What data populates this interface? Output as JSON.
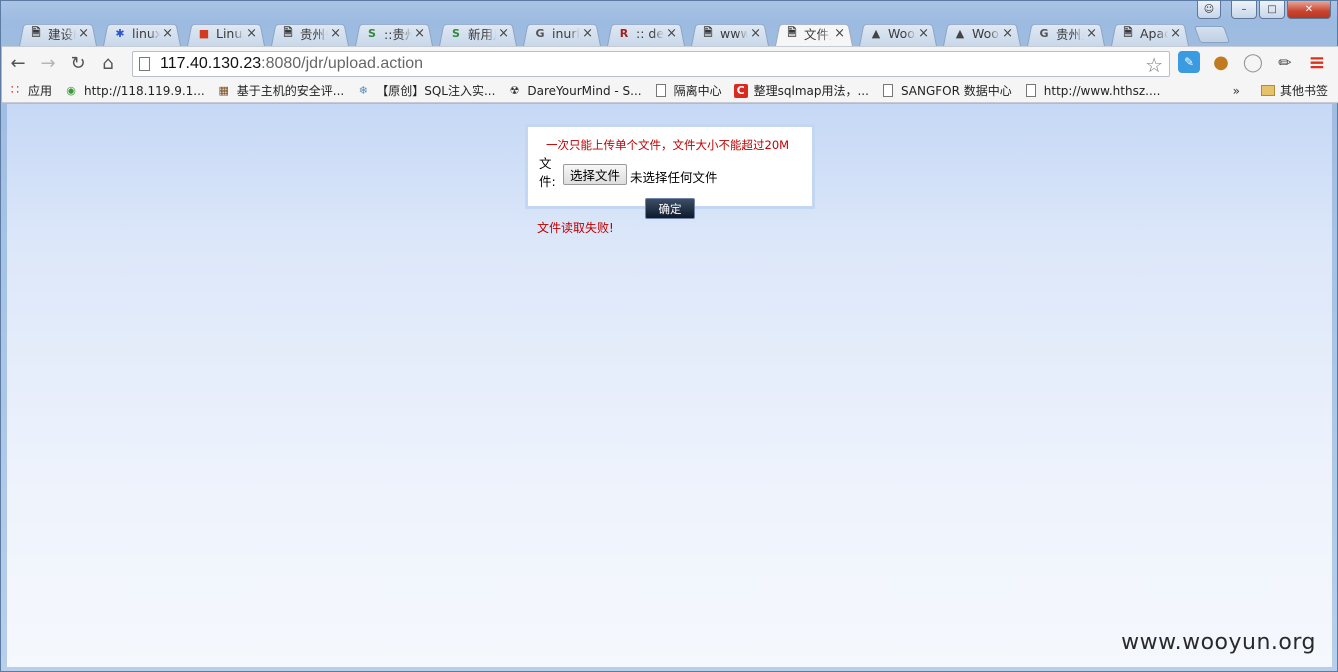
{
  "window": {
    "controls": [
      "user",
      "minimize",
      "maximize",
      "close"
    ]
  },
  "tabs": [
    {
      "title": "建设F",
      "icon": "page-icon",
      "active": false
    },
    {
      "title": "linux",
      "icon": "baidu-paw-icon",
      "active": false
    },
    {
      "title": "Linux",
      "icon": "colorful-logo-icon",
      "active": false
    },
    {
      "title": "贵州省",
      "icon": "page-icon",
      "active": false
    },
    {
      "title": "::贵州",
      "icon": "green-s-icon",
      "active": false
    },
    {
      "title": "新用户",
      "icon": "green-s-icon",
      "active": false
    },
    {
      "title": "inurl:",
      "icon": "google-g-icon",
      "active": false
    },
    {
      "title": ":: dev",
      "icon": "red-r-icon",
      "active": false
    },
    {
      "title": "www",
      "icon": "page-icon",
      "active": false
    },
    {
      "title": "文件上",
      "icon": "page-icon",
      "active": true
    },
    {
      "title": "Woo",
      "icon": "wooyun-icon",
      "active": false
    },
    {
      "title": "Woo",
      "icon": "wooyun-icon",
      "active": false
    },
    {
      "title": "贵州乡",
      "icon": "google-g-icon",
      "active": false
    },
    {
      "title": "Apac",
      "icon": "page-icon",
      "active": false
    }
  ],
  "omnibox": {
    "host": "117.40.130.23",
    "path": ":8080/jdr/upload.action"
  },
  "bookmarks": [
    {
      "label": "应用",
      "icon": "apps-grid-icon"
    },
    {
      "label": "http://118.119.9.1...",
      "icon": "colorful-circle-icon"
    },
    {
      "label": "基于主机的安全评...",
      "icon": "brown-grid-icon"
    },
    {
      "label": "【原创】SQL注入实...",
      "icon": "snowflake-icon"
    },
    {
      "label": "DareYourMind - S...",
      "icon": "radiation-icon"
    },
    {
      "label": "隔离中心",
      "icon": "page-icon"
    },
    {
      "label": "整理sqlmap用法，...",
      "icon": "red-c-icon"
    },
    {
      "label": "SANGFOR 数据中心",
      "icon": "page-icon"
    },
    {
      "label": "http://www.hthsz....",
      "icon": "page-icon"
    }
  ],
  "bookmarks_more": "»",
  "bookmarks_other": "其他书签",
  "upload": {
    "note": "一次只能上传单个文件，文件大小不能超过20M",
    "file_label": "文件:",
    "choose_button": "选择文件",
    "file_status": "未选择任何文件",
    "confirm_button": "确定",
    "error": "文件读取失败!"
  },
  "watermark": "www.wooyun.org"
}
